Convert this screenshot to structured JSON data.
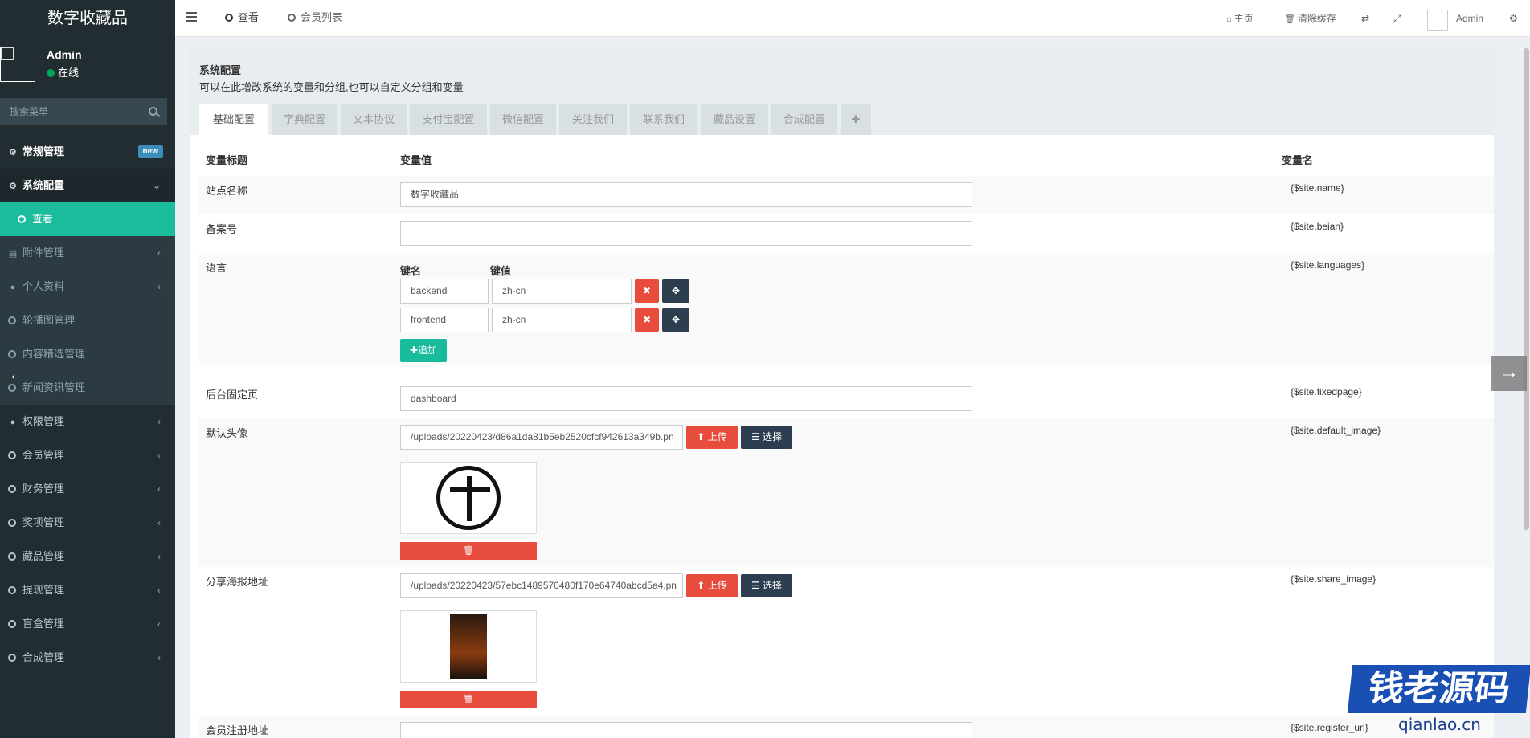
{
  "sidebar": {
    "logo": "数字收藏品",
    "user_name": "Admin",
    "user_status": "在线",
    "search_placeholder": "搜索菜单",
    "menu": {
      "general": "常规管理",
      "general_badge": "new",
      "sysconfig": "系统配置",
      "view": "查看",
      "attachment": "附件管理",
      "profile": "个人资料",
      "carousel": "轮播图管理",
      "featured": "内容精选管理",
      "news": "新闻资讯管理",
      "auth": "权限管理",
      "member": "会员管理",
      "finance": "财务管理",
      "award": "奖项管理",
      "collection": "藏品管理",
      "withdraw": "提现管理",
      "blindbox": "盲盒管理",
      "synth": "合成管理"
    }
  },
  "topbar": {
    "tab_view": "查看",
    "tab_members": "会员列表",
    "home": "主页",
    "clear_cache": "清除缓存",
    "admin": "Admin"
  },
  "panel": {
    "title": "系统配置",
    "desc": "可以在此增改系统的变量和分组,也可以自定义分组和变量",
    "tabs": [
      "基础配置",
      "字典配置",
      "文本协议",
      "支付宝配置",
      "微信配置",
      "关注我们",
      "联系我们",
      "藏品设置",
      "合成配置",
      "✚"
    ]
  },
  "table": {
    "col_title": "变量标题",
    "col_value": "变量值",
    "col_name": "变量名",
    "rows": {
      "site_name": {
        "label": "站点名称",
        "value": "数字收藏品",
        "var": "{$site.name}"
      },
      "beian": {
        "label": "备案号",
        "value": "",
        "var": "{$site.beian}"
      },
      "languages": {
        "label": "语言",
        "var": "{$site.languages}",
        "key_label": "键名",
        "val_label": "键值",
        "items": [
          {
            "key": "backend",
            "val": "zh-cn"
          },
          {
            "key": "frontend",
            "val": "zh-cn"
          }
        ],
        "add": "追加"
      },
      "fixedpage": {
        "label": "后台固定页",
        "value": "dashboard",
        "var": "{$site.fixedpage}"
      },
      "default_image": {
        "label": "默认头像",
        "value": "/uploads/20220423/d86a1da81b5eb2520cfcf942613a349b.pn",
        "var": "{$site.default_image}"
      },
      "share_image": {
        "label": "分享海报地址",
        "value": "/uploads/20220423/57ebc1489570480f170e64740abcd5a4.pn",
        "var": "{$site.share_image}"
      },
      "register_url": {
        "label": "会员注册地址",
        "var": "{$site.register_url}"
      }
    },
    "upload": "上传",
    "choose": "选择"
  },
  "watermark": {
    "main": "钱老源码",
    "sub": "qianlao.cn"
  },
  "colors": {
    "sidebar_bg": "#222d32",
    "active_teal": "#1abc9c",
    "danger": "#e74c3c",
    "dark_btn": "#2c3e50"
  }
}
